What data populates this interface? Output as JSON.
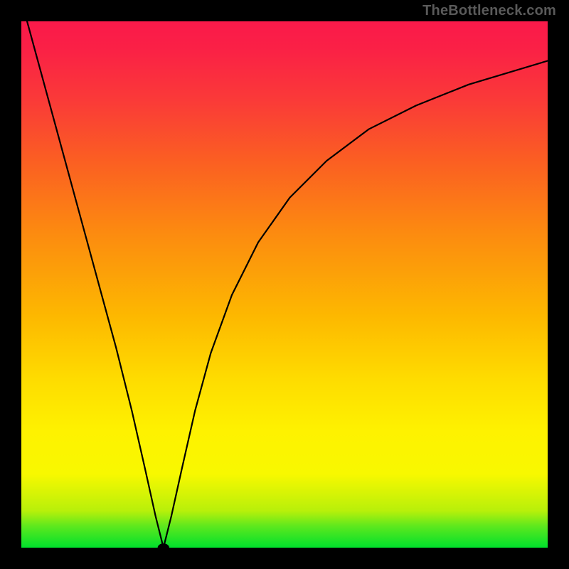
{
  "attribution": "TheBottleneck.com",
  "colors": {
    "background": "#000000",
    "gradient_top": "#fa1a4a",
    "gradient_mid1": "#fc8a10",
    "gradient_mid2": "#fef200",
    "gradient_bottom": "#00e02c",
    "curve": "#000000",
    "marker": "#d88070"
  },
  "chart_data": {
    "type": "line",
    "title": "",
    "xlabel": "",
    "ylabel": "",
    "xlim": [
      0,
      100
    ],
    "ylim": [
      0,
      100
    ],
    "grid": false,
    "comment": "V-shaped bottleneck curve. x is normalized horizontal position (0-100), y is normalized vertical value (0 at bottom, 100 at top). Minimum near x≈27.",
    "series": [
      {
        "name": "curve-left",
        "x": [
          0,
          3,
          6,
          9,
          12,
          15,
          18,
          21,
          23.5,
          25.5,
          27
        ],
        "values": [
          104,
          93,
          82,
          71,
          60,
          49,
          38,
          26,
          15,
          6,
          0
        ]
      },
      {
        "name": "curve-right",
        "x": [
          27,
          28.5,
          30.5,
          33,
          36,
          40,
          45,
          51,
          58,
          66,
          75,
          85,
          100
        ],
        "values": [
          0,
          6,
          15,
          26,
          37,
          48,
          58,
          66.5,
          73.5,
          79.5,
          84,
          88,
          92.5
        ]
      }
    ],
    "marker": {
      "x": 27,
      "y": 0,
      "rx": 1.1,
      "ry": 0.8
    }
  }
}
